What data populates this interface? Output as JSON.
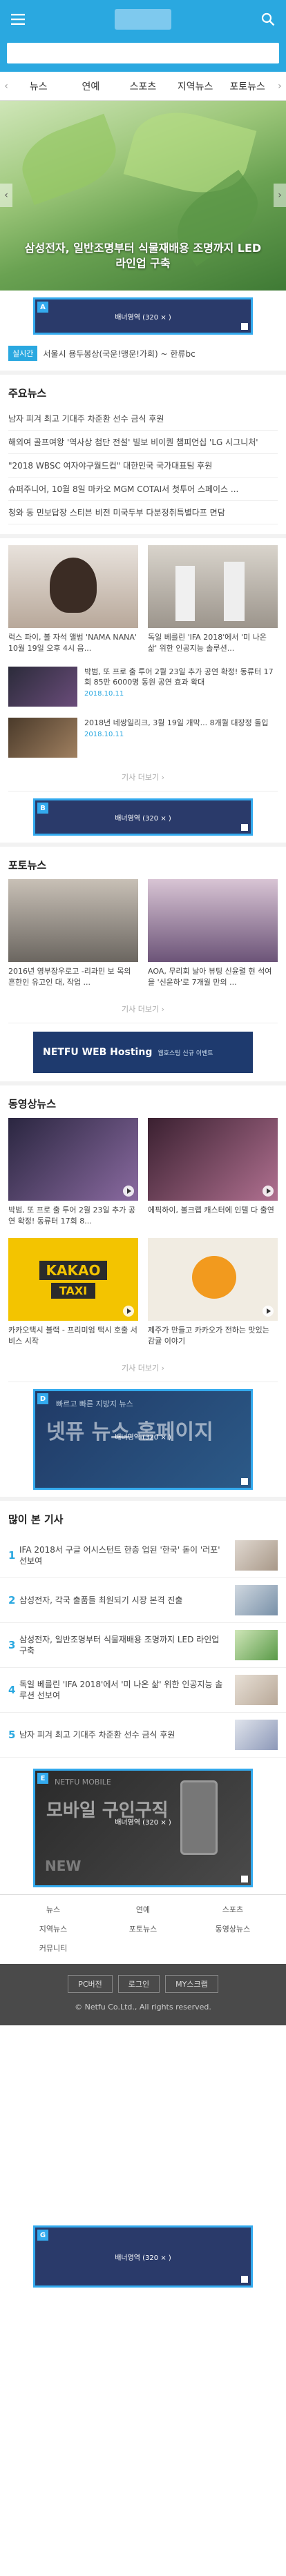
{
  "nav": {
    "prev": "‹",
    "next": "›",
    "tabs": [
      "뉴스",
      "연예",
      "스포츠",
      "지역뉴스",
      "포토뉴스"
    ]
  },
  "hero": {
    "title": "삼성전자, 일반조명부터 식물재배용 조명까지 LED 라인업 구축",
    "prev": "‹",
    "next": "›"
  },
  "ads": [
    {
      "badge": "A",
      "label": "배너영역 (320 × )"
    },
    {
      "badge": "B",
      "label": "배너영역 (320 × )"
    },
    {
      "badge": "D",
      "label": "배너영역 (320 × )"
    },
    {
      "badge": "E",
      "label": "배너영역 (320 × )"
    },
    {
      "badge": "G",
      "label": "배너영역 (320 × )"
    }
  ],
  "breaking": {
    "tag": "실시간",
    "text": "서울시 용두봉상(국운!맹운!가희) ~ 한류bc"
  },
  "main_news": {
    "title": "주요뉴스",
    "items": [
      "남자 피겨 최고 기대주 차준환 선수 금식 후원",
      "해외여 골프여왕 '역사상 첨단 전설' 빌보 비이퀀 챔피언십 'LG 시그니처'",
      "\"2018 WBSC 여자야구월드컵\" 대한민국 국가대표팀 후원",
      "슈퍼주니어, 10월 8일 마카오 MGM COTAI서 첫투어 스페이스 ...",
      "청와 동 민보답장 스티븐 비전 미국두부 다분정취특별다프 면담"
    ],
    "cards": [
      {
        "caption": "럭스 파이, 볼 자석 앨범 'NAMA NANA' 10월 19일 오후 4시 음..."
      },
      {
        "caption": "독일 베를린 'IFA 2018'에서 '미 나온 삶' 위한 인공지능 솔루션..."
      }
    ],
    "rows": [
      {
        "text": "박범, 또 프로 출 투어 2월 23일 추가 공연 확정! 동류터 17회 85만 6000명 동원 공연 효과 확대",
        "date": "2018.10.11"
      },
      {
        "text": "2018년 네쌍일리크, 3월 19일 개막... 8개월 대장정 돌입",
        "date": "2018.10.11"
      }
    ],
    "more": "기사 더보기 ›"
  },
  "photo_news": {
    "title": "포토뉴스",
    "cards": [
      {
        "caption": "2016년 영부장우로고 -리과민 보 목의 흔한인 유고인 대, 작업 ..."
      },
      {
        "caption": "AOA, 무리회 날아 뷰팅 신윤렬 현 석여을 '신윤하'로 7개월 만의 ..."
      }
    ],
    "more": "기사 더보기 ›"
  },
  "hosting_ad": {
    "title": "NETFU WEB Hosting",
    "sub": "웹호스팅 신규 이벤트"
  },
  "video_news": {
    "title": "동영상뉴스",
    "cards": [
      {
        "caption": "박범, 또 프로 출 투어 2월 23일 추가 공연 확정! 동류터 17회 8..."
      },
      {
        "caption": "에픽하이, 볼크랩 캐스터에 인텔 다 출연"
      },
      {
        "caption": "카카오택시 블랙 - 프리미엄 택시 호출 서비스 시작"
      },
      {
        "caption": "제주가 만들고 카카오가 전하는 맛있는 감귤 이야기"
      }
    ],
    "kakao": "KAKAO",
    "taxi": "TAXI",
    "more": "기사 더보기 ›"
  },
  "news_ad": {
    "small": "빠르고 빠른 지방지 뉴스",
    "big": "넷퓨 뉴스 홈페이지"
  },
  "popular": {
    "title": "많이 본 기사",
    "items": [
      {
        "num": "1",
        "text": "IFA 2018서 구글 어시스턴트 한층 업된 '한국' 돋이 '러포' 선보여"
      },
      {
        "num": "2",
        "text": "삼성전자, 각국 출품들 최원되기 시장 본격 진출"
      },
      {
        "num": "3",
        "text": "삼성전자, 일반조명부터 식물재배용 조명까지 LED 라인업 구축"
      },
      {
        "num": "4",
        "text": "독일 베를린 'IFA 2018'에서 '미 나온 삶' 위한 인공지능 솔루션 선보여"
      },
      {
        "num": "5",
        "text": "남자 피겨 최고 기대주 차준환 선수 금식 후원"
      }
    ]
  },
  "mobile_ad": {
    "small": "NETFU MOBILE",
    "big": "모바일 구인구직",
    "new": "NEW"
  },
  "footer_nav": [
    "뉴스",
    "연예",
    "스포츠",
    "지역뉴스",
    "포토뉴스",
    "동영상뉴스",
    "커뮤니티"
  ],
  "footer": {
    "btns": [
      "PC버전",
      "로그인",
      "MY스크랩"
    ],
    "copy": "© Netfu Co.Ltd., All rights reserved."
  },
  "colors": {
    "accent": "#2aa8e0",
    "ad_border": "#33aaee"
  }
}
